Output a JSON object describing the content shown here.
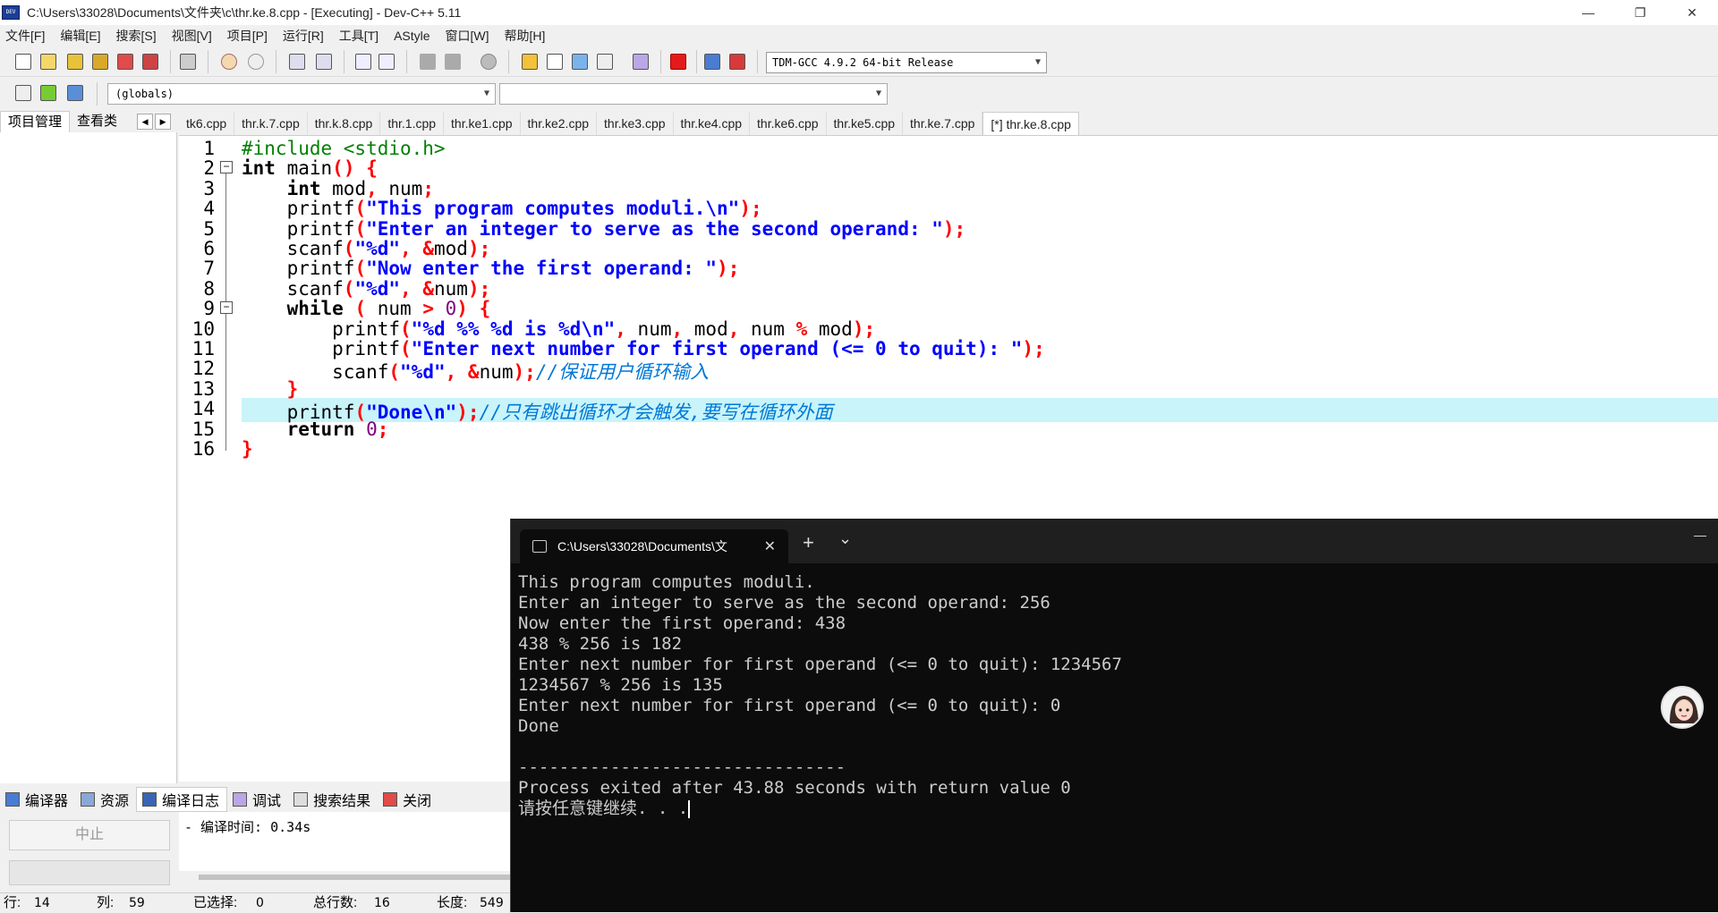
{
  "window": {
    "title": "C:\\Users\\33028\\Documents\\文件夹\\c\\thr.ke.8.cpp - [Executing] - Dev-C++ 5.11",
    "app_icon_text": "DEV",
    "minimize": "—",
    "maximize": "❐",
    "close": "✕"
  },
  "menu": [
    "文件[F]",
    "编辑[E]",
    "搜索[S]",
    "视图[V]",
    "项目[P]",
    "运行[R]",
    "工具[T]",
    "AStyle",
    "窗口[W]",
    "帮助[H]"
  ],
  "toolbar": {
    "compiler": "TDM-GCC 4.9.2 64-bit Release",
    "scope": "(globals)",
    "symbol": ""
  },
  "left_panel": {
    "tabs": [
      "项目管理",
      "查看类"
    ],
    "nav_prev": "◀",
    "nav_next": "▶"
  },
  "file_tabs": [
    "tk6.cpp",
    "thr.k.7.cpp",
    "thr.k.8.cpp",
    "thr.1.cpp",
    "thr.ke1.cpp",
    "thr.ke2.cpp",
    "thr.ke3.cpp",
    "thr.ke4.cpp",
    "thr.ke6.cpp",
    "thr.ke5.cpp",
    "thr.ke.7.cpp",
    "[*] thr.ke.8.cpp"
  ],
  "active_file_tab": 11,
  "editor": {
    "highlighted_line": 14,
    "lines": [
      "#include <stdio.h>",
      "int main() {",
      "    int mod, num;",
      "    printf(\"This program computes moduli.\\n\");",
      "    printf(\"Enter an integer to serve as the second operand: \");",
      "    scanf(\"%d\", &mod);",
      "    printf(\"Now enter the first operand: \");",
      "    scanf(\"%d\", &num);",
      "    while ( num > 0) {",
      "        printf(\"%d %% %d is %d\\n\", num, mod, num % mod);",
      "        printf(\"Enter next number for first operand (<= 0 to quit): \");",
      "        scanf(\"%d\", &num);//保证用户循环输入",
      "    }",
      "    printf(\"Done\\n\");//只有跳出循环才会触发,要写在循环外面",
      "    return 0;",
      "}"
    ]
  },
  "bottom_tabs": [
    "编译器",
    "资源",
    "编译日志",
    "调试",
    "搜索结果",
    "关闭"
  ],
  "bottom_active_tab": 2,
  "bottom_panel": {
    "abort_button": "中止",
    "log_line": "- 编译时间: 0.34s"
  },
  "status_bar": {
    "row_label": "行:",
    "row_value": "14",
    "col_label": "列:",
    "col_value": "59",
    "sel_label": "已选择:",
    "sel_value": "0",
    "total_label": "总行数:",
    "total_value": "16",
    "len_label": "长度:",
    "len_value": "549"
  },
  "terminal": {
    "tab_title": "C:\\Users\\33028\\Documents\\文",
    "tab_close": "✕",
    "new_tab": "+",
    "dropdown": "⌄",
    "minimize": "—",
    "output": [
      "This program computes moduli.",
      "Enter an integer to serve as the second operand: 256",
      "Now enter the first operand: 438",
      "438 % 256 is 182",
      "Enter next number for first operand (<= 0 to quit): 1234567",
      "1234567 % 256 is 135",
      "Enter next number for first operand (<= 0 to quit): 0",
      "Done",
      "",
      "--------------------------------",
      "Process exited after 43.88 seconds with return value 0",
      "请按任意键继续. . ."
    ]
  },
  "colors": {
    "keyword": "#000000",
    "preprocessor": "#008000",
    "string": "#0000ff",
    "symbol": "#ff0000",
    "number": "#800080",
    "comment": "#0078d7",
    "highlight_line": "#c8f4fa",
    "terminal_bg": "#0c0c0c"
  }
}
